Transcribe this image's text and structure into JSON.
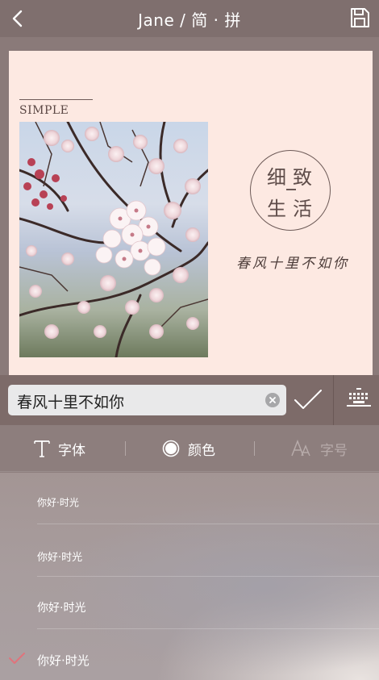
{
  "header": {
    "title": "Jane / 简 · 拼",
    "back_icon": "chevron-left-icon",
    "save_icon": "save-icon"
  },
  "canvas": {
    "simple_label": "SIMPLE",
    "stamp_chars": [
      "细",
      "致",
      "生",
      "活"
    ],
    "script_text": "春风十里不如你",
    "background": "#fde9e2"
  },
  "editor": {
    "input_value": "春风十里不如你",
    "clear_icon": "clear-icon",
    "confirm_icon": "checkmark-icon",
    "keyboard_icon": "keyboard-icon"
  },
  "tabs": [
    {
      "icon": "font-icon",
      "label": "字体",
      "active": false
    },
    {
      "icon": "color-icon",
      "label": "颜色",
      "active": true
    },
    {
      "icon": "font-size-icon",
      "label": "字号",
      "active": false
    }
  ],
  "font_list": [
    {
      "label": "你好·时光",
      "selected": false
    },
    {
      "label": "你好·时光",
      "selected": false
    },
    {
      "label": "你好·时光",
      "selected": false
    },
    {
      "label": "你好·时光",
      "selected": true
    }
  ],
  "colors": {
    "accent_check": "#e0737c",
    "header_bg": "#7f6f6e"
  }
}
